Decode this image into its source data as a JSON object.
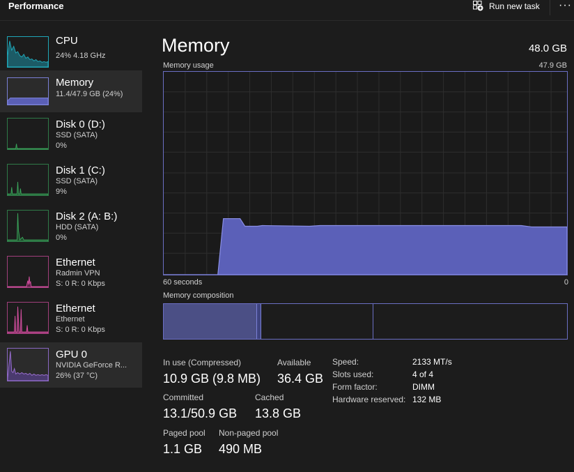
{
  "header": {
    "title": "Performance",
    "run_new_task": "Run new task",
    "more": "···"
  },
  "sidebar": {
    "items": [
      {
        "name": "CPU",
        "line1": "24% 4.18 GHz",
        "line2": ""
      },
      {
        "name": "Memory",
        "line1": "11.4/47.9 GB (24%)",
        "line2": ""
      },
      {
        "name": "Disk 0 (D:)",
        "line1": "SSD (SATA)",
        "line2": "0%"
      },
      {
        "name": "Disk 1 (C:)",
        "line1": "SSD (SATA)",
        "line2": "9%"
      },
      {
        "name": "Disk 2 (A: B:)",
        "line1": "HDD (SATA)",
        "line2": "0%"
      },
      {
        "name": "Ethernet",
        "line1": "Radmin VPN",
        "line2": "S: 0 R: 0 Kbps"
      },
      {
        "name": "Ethernet",
        "line1": "Ethernet",
        "line2": "S: 0 R: 0 Kbps"
      },
      {
        "name": "GPU 0",
        "line1": "NVIDIA GeForce R...",
        "line2": "26% (37 °C)"
      }
    ]
  },
  "main": {
    "title": "Memory",
    "total": "48.0 GB",
    "usage_label": "Memory usage",
    "usage_max": "47.9 GB",
    "time_left": "60 seconds",
    "time_right": "0",
    "composition_label": "Memory composition"
  },
  "stats": {
    "in_use_label": "In use (Compressed)",
    "in_use_value": "10.9 GB (9.8 MB)",
    "available_label": "Available",
    "available_value": "36.4 GB",
    "committed_label": "Committed",
    "committed_value": "13.1/50.9 GB",
    "cached_label": "Cached",
    "cached_value": "13.8 GB",
    "paged_label": "Paged pool",
    "paged_value": "1.1 GB",
    "nonpaged_label": "Non-paged pool",
    "nonpaged_value": "490 MB"
  },
  "details": {
    "speed_label": "Speed:",
    "speed_value": "2133 MT/s",
    "slots_label": "Slots used:",
    "slots_value": "4 of 4",
    "form_label": "Form factor:",
    "form_value": "DIMM",
    "reserved_label": "Hardware reserved:",
    "reserved_value": "132 MB"
  },
  "colors": {
    "memory_accent": "#7a80d6",
    "cpu_accent": "#1fa7b8",
    "disk_accent": "#3aa35a",
    "ethernet_accent": "#d44fa0",
    "gpu_accent": "#9a6fd0"
  }
}
